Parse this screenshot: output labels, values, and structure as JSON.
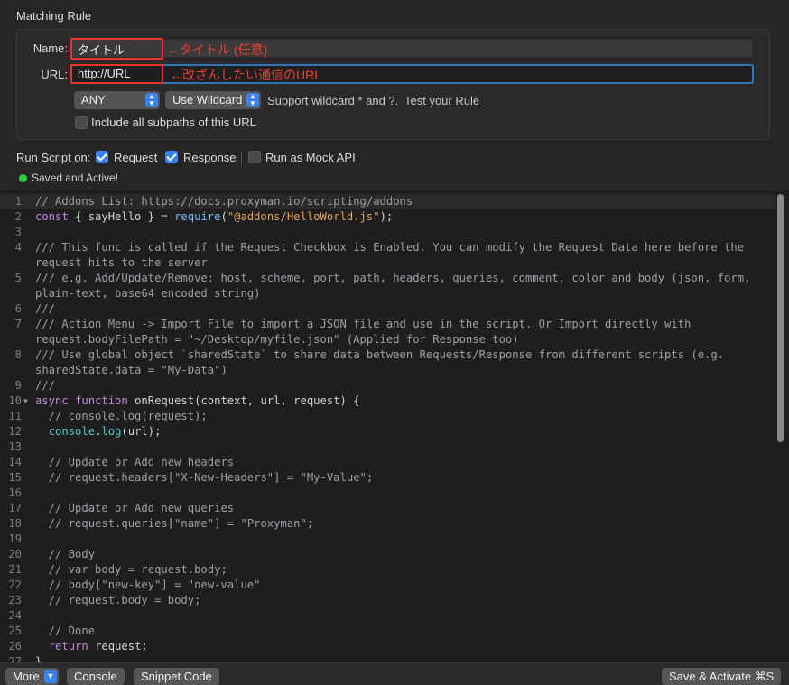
{
  "header": {
    "title": "Matching Rule"
  },
  "rule": {
    "name_label": "Name:",
    "name_value": "タイトル",
    "name_annotation": "←タイトル (任意)",
    "url_label": "URL:",
    "url_value": "http://URL",
    "url_annotation": "←改ざんしたい通信のURL",
    "method_value": "ANY",
    "match_value": "Use Wildcard",
    "hint": "Support wildcard * and ?.",
    "test_link": "Test your Rule",
    "subpaths_label": "Include all subpaths of this URL",
    "subpaths_checked": false
  },
  "run_script": {
    "label": "Run Script on:",
    "request_label": "Request",
    "request_checked": true,
    "response_label": "Response",
    "response_checked": true,
    "mock_label": "Run as Mock API",
    "mock_checked": false
  },
  "status": {
    "text": "Saved and Active!",
    "color": "#2ecc40"
  },
  "editor": {
    "lines": [
      {
        "n": "1",
        "t": "// Addons List: https://docs.proxyman.io/scripting/addons"
      },
      {
        "n": "2",
        "t": "const { sayHello } = require(\"@addons/HelloWorld.js\");"
      },
      {
        "n": "3",
        "t": ""
      },
      {
        "n": "4",
        "t": "/// This func is called if the Request Checkbox is Enabled. You can modify the Request Data here before the"
      },
      {
        "n": "",
        "t": "request hits to the server"
      },
      {
        "n": "5",
        "t": "/// e.g. Add/Update/Remove: host, scheme, port, path, headers, queries, comment, color and body (json, form,"
      },
      {
        "n": "",
        "t": "plain-text, base64 encoded string)"
      },
      {
        "n": "6",
        "t": "///"
      },
      {
        "n": "7",
        "t": "/// Action Menu -> Import File to import a JSON file and use in the script. Or Import directly with"
      },
      {
        "n": "",
        "t": "request.bodyFilePath = \"~/Desktop/myfile.json\" (Applied for Response too)"
      },
      {
        "n": "8",
        "t": "/// Use global object `sharedState` to share data between Requests/Response from different scripts (e.g."
      },
      {
        "n": "",
        "t": "sharedState.data = \"My-Data\")"
      },
      {
        "n": "9",
        "t": "///"
      },
      {
        "n": "10",
        "t": "async function onRequest(context, url, request) {"
      },
      {
        "n": "11",
        "t": "  // console.log(request);"
      },
      {
        "n": "12",
        "t": "  console.log(url);"
      },
      {
        "n": "13",
        "t": ""
      },
      {
        "n": "14",
        "t": "  // Update or Add new headers"
      },
      {
        "n": "15",
        "t": "  // request.headers[\"X-New-Headers\"] = \"My-Value\";"
      },
      {
        "n": "16",
        "t": ""
      },
      {
        "n": "17",
        "t": "  // Update or Add new queries"
      },
      {
        "n": "18",
        "t": "  // request.queries[\"name\"] = \"Proxyman\";"
      },
      {
        "n": "19",
        "t": ""
      },
      {
        "n": "20",
        "t": "  // Body"
      },
      {
        "n": "21",
        "t": "  // var body = request.body;"
      },
      {
        "n": "22",
        "t": "  // body[\"new-key\"] = \"new-value\""
      },
      {
        "n": "23",
        "t": "  // request.body = body;"
      },
      {
        "n": "24",
        "t": ""
      },
      {
        "n": "25",
        "t": "  // Done"
      },
      {
        "n": "26",
        "t": "  return request;"
      },
      {
        "n": "27",
        "t": "}"
      }
    ]
  },
  "bottombar": {
    "more_label": "More",
    "console_label": "Console",
    "snippet_label": "Snippet Code",
    "save_label": "Save & Activate ⌘S"
  }
}
